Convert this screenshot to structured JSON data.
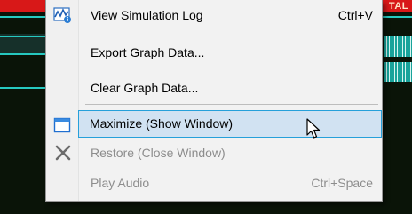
{
  "background": {
    "label": "TAL",
    "top_bar_color": "#d81818",
    "line_color": "#26c9c0"
  },
  "menu": {
    "items": [
      {
        "label": "View Simulation Log",
        "shortcut": "Ctrl+V",
        "icon": "simulation-log-icon",
        "enabled": true
      },
      {
        "label": "Export Graph Data...",
        "shortcut": "",
        "enabled": true
      },
      {
        "label": "Clear Graph Data...",
        "shortcut": "",
        "enabled": true
      },
      {
        "label": "Maximize (Show Window)",
        "shortcut": "",
        "icon": "maximize-window-icon",
        "enabled": true,
        "highlighted": true
      },
      {
        "label": "Restore (Close Window)",
        "shortcut": "",
        "icon": "close-x-icon",
        "enabled": false
      },
      {
        "label": "Play Audio",
        "shortcut": "Ctrl+Space",
        "enabled": false
      }
    ],
    "highlight_color": "#d1e2f2",
    "highlight_border": "#26a0da"
  }
}
